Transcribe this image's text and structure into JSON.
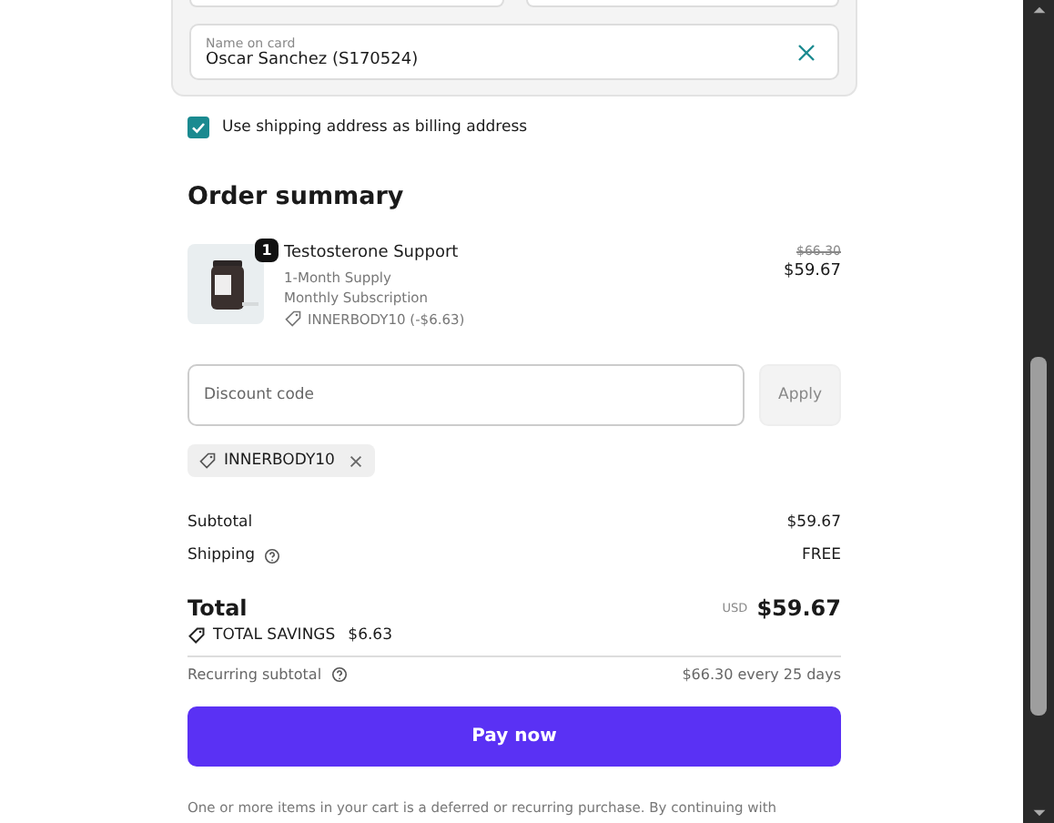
{
  "name_on_card": {
    "label": "Name on card",
    "value": "Oscar Sanchez (S170524)"
  },
  "billing_checkbox": {
    "label": "Use shipping address as billing address",
    "checked": true
  },
  "order_summary": {
    "title": "Order summary",
    "items": [
      {
        "quantity": "1",
        "name": "Testosterone Support",
        "details": [
          "1-Month Supply",
          "Monthly Subscription"
        ],
        "discount": "INNERBODY10 (-$6.63)",
        "original_price": "$66.30",
        "price": "$59.67"
      }
    ]
  },
  "discount": {
    "placeholder": "Discount code",
    "button": "Apply",
    "applied_codes": [
      "INNERBODY10"
    ]
  },
  "lines": [
    {
      "label": "Subtotal",
      "value": "$59.67",
      "info": false
    },
    {
      "label": "Shipping",
      "value": "FREE",
      "info": true
    }
  ],
  "total": {
    "label": "Total",
    "currency": "USD",
    "value": "$59.67",
    "savings_label": "TOTAL SAVINGS",
    "savings_value": "$6.63"
  },
  "recurring": {
    "label": "Recurring subtotal",
    "value": "$66.30 every 25 days"
  },
  "pay_button": "Pay now",
  "footnote": "One or more items in your cart is a deferred or recurring purchase. By continuing with"
}
